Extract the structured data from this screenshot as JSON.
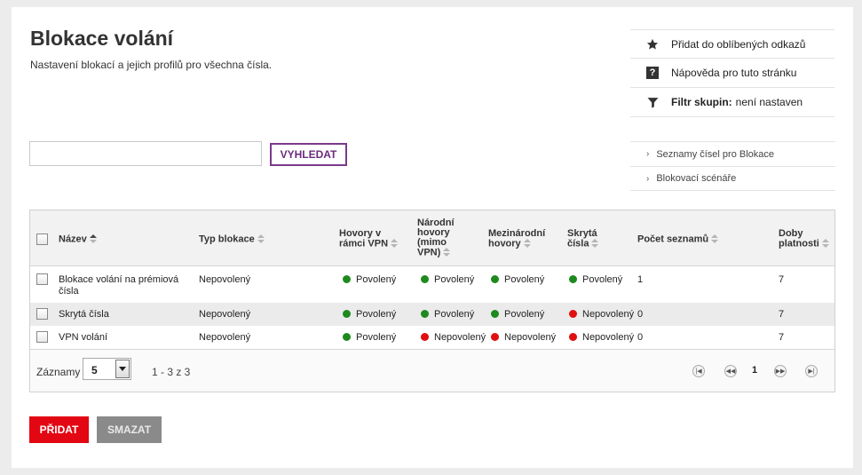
{
  "header": {
    "title": "Blokace volání",
    "subtitle": "Nastavení blokací a jejich profilů pro všechna čísla."
  },
  "side_actions": {
    "favorite": "Přidat do oblíbených odkazů",
    "help": "Nápověda pro tuto stránku",
    "help_glyph": "?",
    "filter_label": "Filtr skupin:",
    "filter_value": "není nastaven"
  },
  "side_links": [
    "Seznamy čísel pro Blokace",
    "Blokovací scénáře"
  ],
  "search": {
    "value": "",
    "placeholder": "",
    "button": "VYHLEDAT"
  },
  "table": {
    "columns": {
      "name": "Název",
      "type": "Typ blokace",
      "vpn": [
        "Hovory v",
        "rámci VPN"
      ],
      "national": [
        "Národní",
        "hovory",
        "(mimo",
        "VPN)"
      ],
      "international": [
        "Mezinárodní",
        "hovory"
      ],
      "hidden": [
        "Skrytá",
        "čísla"
      ],
      "lists": "Počet seznamů",
      "validity": [
        "Doby",
        "platnosti"
      ]
    },
    "rows": [
      {
        "name": [
          "Blokace volání na prémiová",
          "čísla"
        ],
        "type": "Nepovolený",
        "vpn": "Povolený",
        "vpn_ok": true,
        "national": "Povolený",
        "national_ok": true,
        "international": "Povolený",
        "international_ok": true,
        "hidden": "Povolený",
        "hidden_ok": true,
        "lists": "1",
        "validity": "7"
      },
      {
        "name": [
          "Skrytá čísla"
        ],
        "type": "Nepovolený",
        "vpn": "Povolený",
        "vpn_ok": true,
        "national": "Povolený",
        "national_ok": true,
        "international": "Povolený",
        "international_ok": true,
        "hidden": "Nepovolený",
        "hidden_ok": false,
        "lists": "0",
        "validity": "7"
      },
      {
        "name": [
          "VPN volání"
        ],
        "type": "Nepovolený",
        "vpn": "Povolený",
        "vpn_ok": true,
        "national": "Nepovolený",
        "national_ok": false,
        "international": "Nepovolený",
        "international_ok": false,
        "hidden": "Nepovolený",
        "hidden_ok": false,
        "lists": "0",
        "validity": "7"
      }
    ]
  },
  "pagination": {
    "records_label": "Záznamy",
    "page_size": "5",
    "range": "1 - 3 z 3",
    "current_page": "1"
  },
  "buttons": {
    "add": "PŘIDAT",
    "delete": "SMAZAT"
  },
  "colors": {
    "accent_red": "#e30613",
    "accent_purple": "#7a3a8a",
    "status_ok": "#1e8a1e",
    "status_no": "#e01010"
  }
}
